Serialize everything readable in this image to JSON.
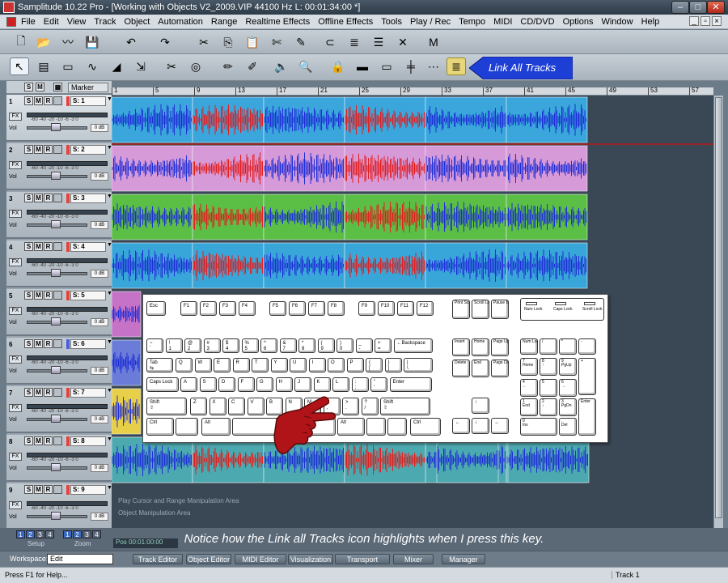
{
  "window": {
    "title": "Samplitude 10.22 Pro - [Working with Objects V2_2009.VIP    44100 Hz L: 00:01:34:00 *]"
  },
  "menu": [
    "File",
    "Edit",
    "View",
    "Track",
    "Object",
    "Automation",
    "Range",
    "Realtime Effects",
    "Offline Effects",
    "Tools",
    "Play / Rec",
    "Tempo",
    "MIDI",
    "CD/DVD",
    "Options",
    "Window",
    "Help"
  ],
  "toolbar2": {
    "callout_label": "Link All Tracks",
    "accent": "#1e3fd6"
  },
  "track_header": {
    "solo": "S",
    "mute": "M",
    "marker_label": "Marker"
  },
  "ruler": {
    "ticks": [
      "1",
      "5",
      "9",
      "13",
      "17",
      "21",
      "25",
      "29",
      "33",
      "37",
      "41",
      "45",
      "49",
      "53",
      "57"
    ]
  },
  "tracks": [
    {
      "num": "1",
      "name": "S: 1",
      "color": "#e8413c"
    },
    {
      "num": "2",
      "name": "S: 2",
      "color": "#e8413c"
    },
    {
      "num": "3",
      "name": "S: 3",
      "color": "#e8413c"
    },
    {
      "num": "4",
      "name": "S: 4",
      "color": "#e8413c"
    },
    {
      "num": "5",
      "name": "S: 5",
      "color": "#e8413c"
    },
    {
      "num": "6",
      "name": "S: 6",
      "color": "#4b5de0"
    },
    {
      "num": "7",
      "name": "S: 7",
      "color": "#e8413c"
    },
    {
      "num": "8",
      "name": "S: 8",
      "color": "#e8413c"
    },
    {
      "num": "9",
      "name": "S: 9",
      "color": "#e8413c"
    }
  ],
  "track_controls": {
    "solo": "S",
    "mute": "M",
    "record": "R",
    "fx": "FX",
    "vol": "Vol",
    "db": "0 dB",
    "meter_scale": "-60  -40  -20 -10  -6 -3  0"
  },
  "arrange": {
    "label_playcursor": "Play Cursor and Range Manipulation Area",
    "label_object": "Object Manipulation Area"
  },
  "keyboard": {
    "fkeys": [
      "Esc",
      "F1",
      "F2",
      "F3",
      "F4",
      "F5",
      "F6",
      "F7",
      "F8",
      "F9",
      "F10",
      "F11",
      "F12"
    ],
    "sys_keys": [
      "Print Screen SysRq",
      "Scroll Lock",
      "Pause Break"
    ],
    "lock_labels": [
      "Num Lock",
      "Caps Lock",
      "Scroll Lock"
    ],
    "row1": [
      "~\n`",
      "!\n1",
      "@\n2",
      "#\n3",
      "$\n4",
      "%\n5",
      "^\n6",
      "&\n7",
      "*\n8",
      "(\n9",
      ")\n0",
      "_\n-",
      "+\n=",
      "←Backspace"
    ],
    "row2": [
      "Tab\n⇆",
      "Q",
      "W",
      "E",
      "R",
      "T",
      "Y",
      "U",
      "I",
      "O",
      "P",
      "{\n[",
      "}\n]",
      "|\n\\"
    ],
    "row3": [
      "Caps Lock",
      "A",
      "S",
      "D",
      "F",
      "G",
      "H",
      "J",
      "K",
      "L",
      ":\n;",
      "\"\n'",
      "Enter"
    ],
    "row4": [
      "Shift\n⇧",
      "Z",
      "X",
      "C",
      "V",
      "B",
      "N",
      "M",
      "<\n,",
      ">\n.",
      "?\n/",
      "Shift\n⇧"
    ],
    "row5": [
      "Ctrl",
      "",
      "Alt",
      "",
      "Alt",
      "",
      "",
      "Ctrl"
    ],
    "nav": [
      "Insert",
      "Home",
      "Page Up",
      "Delete",
      "End",
      "Page Down"
    ],
    "arrows": [
      "↑",
      "←",
      "↓",
      "→"
    ],
    "numpad": [
      "Num Lock",
      "/",
      "*",
      "-",
      "7\nHome",
      "8\n↑",
      "9\nPgUp",
      "+",
      "4\n←",
      "5",
      "6\n→",
      "1\nEnd",
      "2\n↓",
      "3\nPgDn",
      "Enter",
      "0\nIns",
      ".\nDel"
    ]
  },
  "bottom": {
    "caption": "Notice how the Link all Tracks icon highlights when I press this key.",
    "setup_nums": [
      "1",
      "2",
      "3",
      "4"
    ],
    "zoom_nums": [
      "1",
      "2",
      "3",
      "4"
    ],
    "setup_label": "Setup",
    "zoom_label": "Zoom",
    "workspace_label": "Workspace:",
    "workspace_value": "Edit",
    "tabs": [
      "Track Editor",
      "Object Editor",
      "MIDI Editor",
      "Visualization",
      "Transport",
      "Mixer",
      "Manager"
    ],
    "time_fragment": "Pos   00:01:00:00",
    "status_left": "Press F1 for Help...",
    "status_right": "Track 1"
  },
  "colors": {
    "wave_blue": "#1f2fd6",
    "wave_red": "#e21f1f",
    "hand": "#b01418"
  }
}
